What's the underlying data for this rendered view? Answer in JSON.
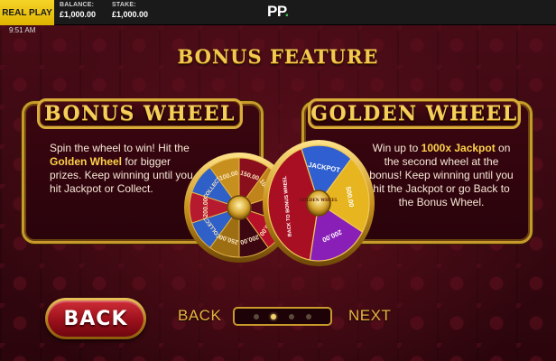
{
  "topbar": {
    "mode_label": "REAL PLAY",
    "balance_label": "BALANCE:",
    "balance_value": "£1,000.00",
    "stake_label": "STAKE:",
    "stake_value": "£1,000.00",
    "logo_text": "PP",
    "logo_dot": "."
  },
  "status": {
    "time": "9:51 AM"
  },
  "page": {
    "title": "BONUS FEATURE"
  },
  "bonus_wheel_panel": {
    "heading": "BONUS WHEEL",
    "text_1": "Spin the wheel to win! Hit the ",
    "text_highlight": "Golden Wheel",
    "text_2": " for bigger prizes. Keep winning until you hit Jackpot or Collect."
  },
  "golden_wheel_panel": {
    "heading": "GOLDEN WHEEL",
    "text_1": "Win up to ",
    "text_highlight": "1000x Jackpot",
    "text_2": " on the second wheel at the bonus! Keep winning until you hit the Jackpot or go Back to the Bonus Wheel."
  },
  "bonus_wheel": {
    "hub_label": "GOLDEN WHEEL",
    "segments": [
      "150.00",
      "100.00",
      "250.00",
      "150.00",
      "200.00",
      "250.00",
      "COLLECT",
      "200.00",
      "COLLECT",
      "100.00"
    ]
  },
  "golden_wheel": {
    "hub_label": "GOLDEN WHEEL",
    "segments": [
      "JACKPOT",
      "500.00",
      "200.00",
      "BACK TO BONUS WHEEL"
    ]
  },
  "bottom": {
    "back_button": "BACK",
    "nav_back": "BACK",
    "nav_next": "NEXT",
    "pages": 4,
    "active_page": 1
  },
  "colors": {
    "gold": "#f2c84e",
    "background": "#3a0a12",
    "button_red": "#b0161f",
    "accent_yellow": "#ffd24a"
  }
}
